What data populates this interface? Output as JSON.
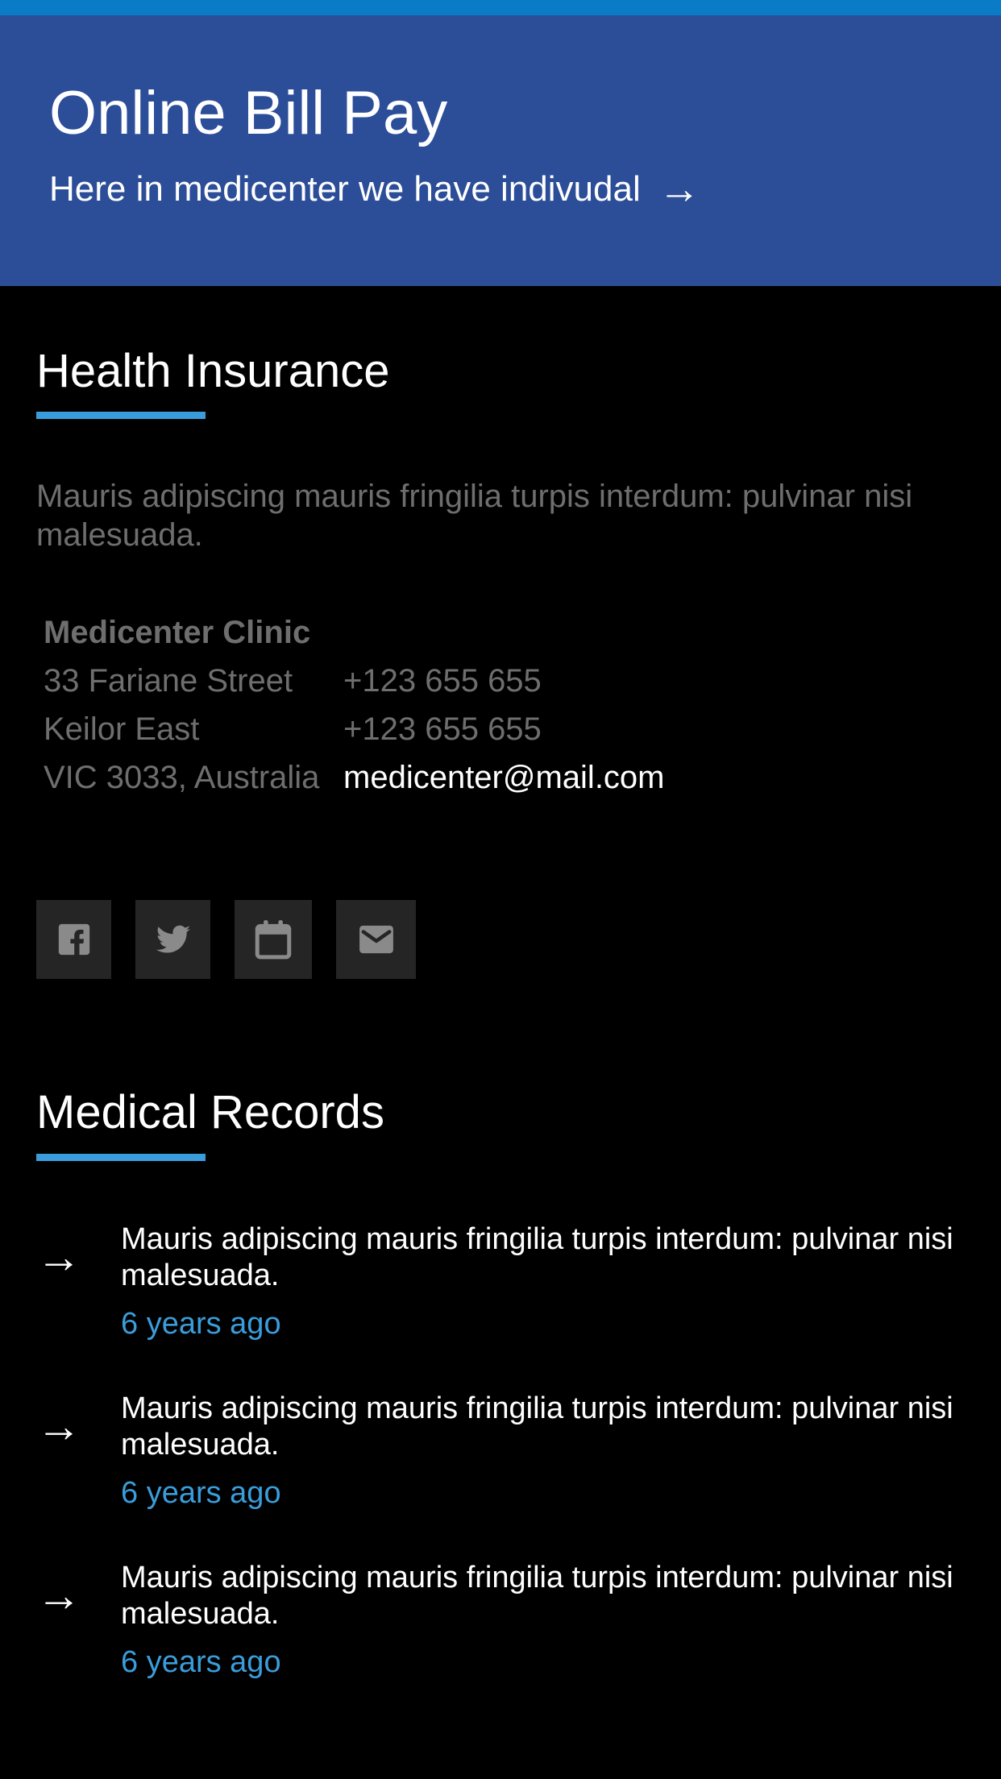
{
  "banner": {
    "title": "Online Bill Pay",
    "link_text": "Here in medicenter we have indivudal",
    "link_arrow": "→",
    "background": "#2c4e98",
    "strip_color": "#0a7bc6"
  },
  "health_insurance": {
    "title": "Health Insurance",
    "description": "Mauris adipiscing mauris fringilia turpis interdum: pulvinar nisi malesuada.",
    "clinic_name": "Medicenter Clinic",
    "address": [
      "33 Fariane Street",
      "Keilor East",
      "VIC 3033, Australia"
    ],
    "phones": [
      "+123 655 655",
      "+123 655 655"
    ],
    "email": "medicenter@mail.com"
  },
  "social_icons": [
    "facebook-icon",
    "twitter-icon",
    "calendar-icon",
    "mail-icon"
  ],
  "medical_records": {
    "title": "Medical Records",
    "items": [
      {
        "arrow": "→",
        "text": "Mauris adipiscing mauris fringilia turpis interdum: pulvinar nisi malesuada.",
        "time": "6 years ago"
      },
      {
        "arrow": "→",
        "text": "Mauris adipiscing mauris fringilia turpis interdum: pulvinar nisi malesuada.",
        "time": "6 years ago"
      },
      {
        "arrow": "→",
        "text": "Mauris adipiscing mauris fringilia turpis interdum: pulvinar nisi malesuada.",
        "time": "6 years ago"
      }
    ]
  },
  "colors": {
    "accent": "#3a9ddb",
    "muted_text": "#6e6e6e",
    "icon_tile": "#252525",
    "icon_glyph": "#8a8a8a"
  }
}
